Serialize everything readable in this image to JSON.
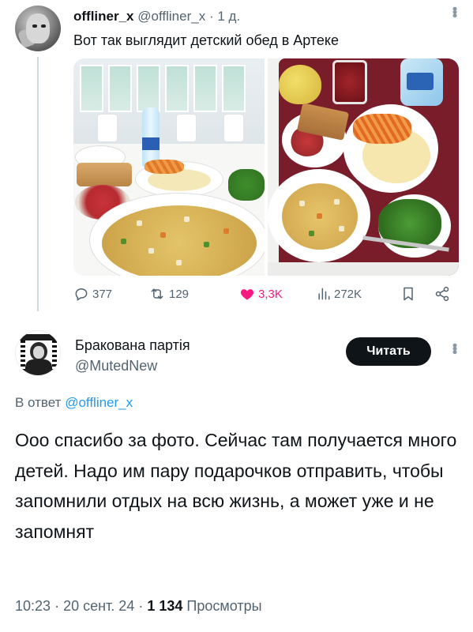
{
  "original_tweet": {
    "name": "offliner_x",
    "handle": "@offliner_x",
    "separator": "·",
    "time": "1 д.",
    "text": "Вот так выглядит детский обед в Артеке",
    "more_icon": "more-vertical-icon",
    "stats": {
      "replies": "377",
      "retweets": "129",
      "likes": "3,3K",
      "views": "272K"
    },
    "like_color": "#f91880",
    "photos": [
      "canteen-lunch-photo",
      "tray-lunch-photo"
    ]
  },
  "reply": {
    "name": "Бракована партія",
    "handle": "@MutedNew",
    "follow_label": "Читать",
    "in_reply_prefix": "В ответ",
    "in_reply_mention": "@offliner_x",
    "text": "Ооо спасибо за фото. Сейчас там получается много детей. Надо им пару подарочков отправить, чтобы запомнили отдых на всю жизнь, а может уже и не запомнят",
    "time": "10:23",
    "date": "20 сент. 24",
    "sep": "·",
    "views_count": "1 134",
    "views_label": "Просмотры"
  },
  "colors": {
    "text": "#0f1419",
    "muted": "#536471",
    "link": "#1d9bf0",
    "button_bg": "#0f1419"
  }
}
